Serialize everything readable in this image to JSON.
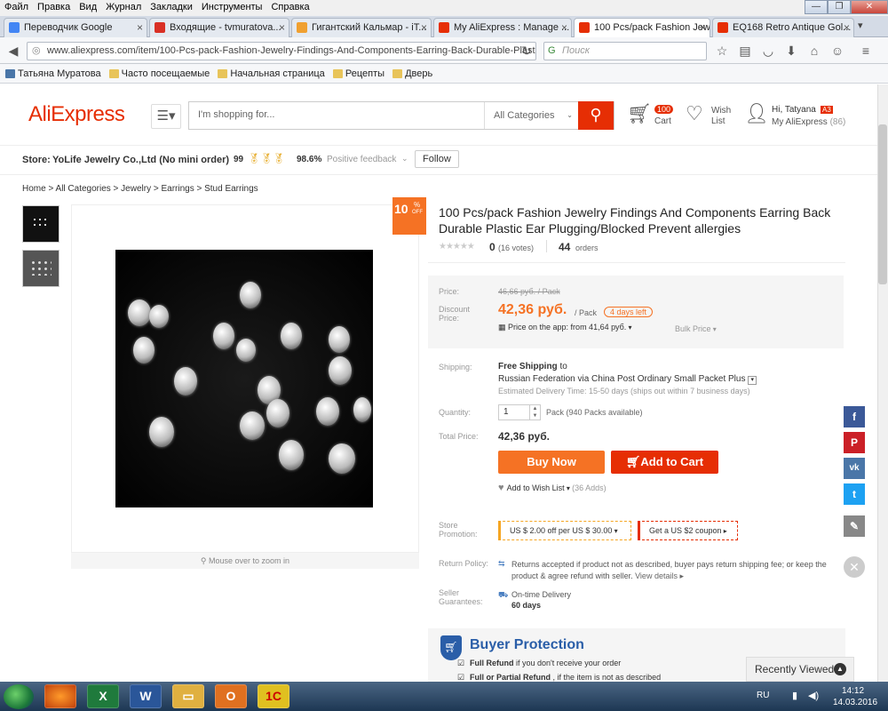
{
  "browser": {
    "menu": [
      "Файл",
      "Правка",
      "Вид",
      "Журнал",
      "Закладки",
      "Инструменты",
      "Справка"
    ],
    "tabs": [
      {
        "label": "Переводчик Google",
        "icon_color": "#4285f4"
      },
      {
        "label": "Входящие - tvmuratova...",
        "icon_color": "#d93025"
      },
      {
        "label": "Гигантский Кальмар - iT...",
        "icon_color": "#f0a030"
      },
      {
        "label": "My AliExpress : Manage ...",
        "icon_color": "#e62e04"
      },
      {
        "label": "100 Pcs/pack Fashion Jew...",
        "icon_color": "#e62e04"
      },
      {
        "label": "EQ168 Retro Antique Gol...",
        "icon_color": "#e62e04"
      }
    ],
    "url": "www.aliexpress.com/item/100-Pcs-pack-Fashion-Jewelry-Findings-And-Components-Earring-Back-Durable-Plastic-Ear-Pl",
    "search_placeholder": "Поиск",
    "bookmarks": [
      "Татьяна Муратова",
      "Часто посещаемые",
      "Начальная страница",
      "Рецепты",
      "Дверь"
    ]
  },
  "header": {
    "logo": "AliExpress",
    "search_placeholder": "I'm shopping for...",
    "category": "All Categories",
    "cart_count": "100",
    "cart_label": "Cart",
    "wish_label_1": "Wish",
    "wish_label_2": "List",
    "greeting": "Hi, Tatyana",
    "badge": "A3",
    "my_ali": "My AliExpress",
    "my_ali_count": "(86)"
  },
  "store": {
    "label": "Store:",
    "name": "YoLife Jewelry Co.,Ltd (No mini order)",
    "score": "99",
    "feedback_pct": "98.6%",
    "feedback_label": "Positive feedback",
    "follow": "Follow"
  },
  "breadcrumb": "Home > All Categories > Jewelry > Earrings > Stud Earrings",
  "product": {
    "discount": "10",
    "discount_pct": "%",
    "discount_off": "OFF",
    "title": "100 Pcs/pack Fashion Jewelry Findings And Components Earring Back Durable Plastic Ear Plugging/Blocked Prevent allergies",
    "rating": "0",
    "votes": "(16 votes)",
    "orders": "44",
    "orders_label": "orders",
    "zoom_hint": "Mouse over to zoom in"
  },
  "price": {
    "price_label": "Price:",
    "old_price": "46,66 руб. / Pack",
    "discount_label_1": "Discount",
    "discount_label_2": "Price:",
    "new_price": "42,36 руб.",
    "per": "/ Pack",
    "days_left": "4 days left",
    "app_price": "Price on the app: from 41,64 руб.",
    "bulk": "Bulk Price"
  },
  "shipping": {
    "label": "Shipping:",
    "free": "Free Shipping",
    "to": "to",
    "dest": "Russian Federation via China Post Ordinary Small Packet Plus",
    "eta": "Estimated Delivery Time: 15-50 days (ships out within 7 business days)"
  },
  "quantity": {
    "label": "Quantity:",
    "value": "1",
    "available": "Pack (940 Packs available)"
  },
  "total": {
    "label": "Total Price:",
    "value": "42,36 руб."
  },
  "actions": {
    "buy": "Buy Now",
    "cart": "Add to Cart",
    "wish": "Add to Wish List",
    "wish_count": "(36 Adds)"
  },
  "promotion": {
    "label_1": "Store",
    "label_2": "Promotion:",
    "offer": "US $ 2.00 off per US $ 30.00",
    "coupon": "Get a US $2 coupon"
  },
  "return_policy": {
    "label": "Return Policy:",
    "text": "Returns accepted if product not as described, buyer pays return shipping fee; or keep the product & agree refund with seller.",
    "details": "View details"
  },
  "guarantees": {
    "label_1": "Seller",
    "label_2": "Guarantees:",
    "item": "On-time Delivery",
    "days": "60 days"
  },
  "buyer_protection": {
    "title": "Buyer Protection",
    "line1_bold": "Full Refund",
    "line1": "if you don't receive your order",
    "line2_bold": "Full or Partial Refund",
    "line2": ", if the item is not as described"
  },
  "recently_viewed": "Recently Viewed",
  "tray": {
    "lang": "RU",
    "time": "14:12",
    "date": "14.03.2016"
  }
}
